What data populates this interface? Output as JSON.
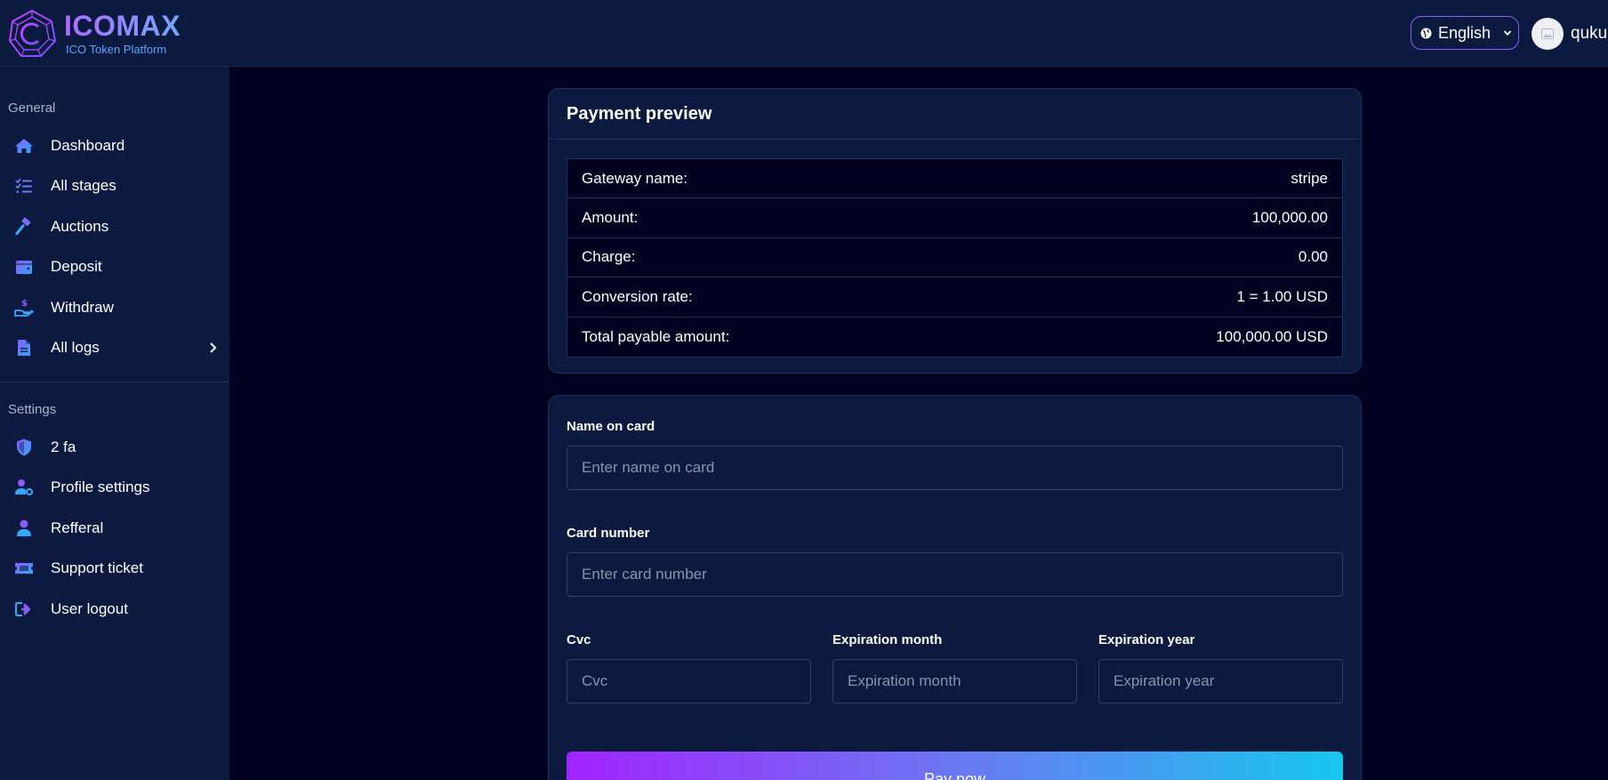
{
  "header": {
    "brand_title": "ICOMAX",
    "brand_subtitle": "ICO Token Platform",
    "language": "English",
    "username": "qukuq"
  },
  "sidebar": {
    "general_title": "General",
    "general_items": [
      {
        "label": "Dashboard",
        "icon": "home-icon"
      },
      {
        "label": "All stages",
        "icon": "list-icon"
      },
      {
        "label": "Auctions",
        "icon": "gavel-icon"
      },
      {
        "label": "Deposit",
        "icon": "wallet-icon"
      },
      {
        "label": "Withdraw",
        "icon": "hand-dollar-icon"
      },
      {
        "label": "All logs",
        "icon": "file-icon"
      }
    ],
    "settings_title": "Settings",
    "settings_items": [
      {
        "label": "2 fa",
        "icon": "shield-icon"
      },
      {
        "label": "Profile settings",
        "icon": "user-gear-icon"
      },
      {
        "label": "Refferal",
        "icon": "user-icon"
      },
      {
        "label": "Support ticket",
        "icon": "ticket-icon"
      },
      {
        "label": "User logout",
        "icon": "logout-icon"
      }
    ]
  },
  "payment_preview": {
    "title": "Payment preview",
    "rows": [
      {
        "label": "Gateway name:",
        "value": "stripe"
      },
      {
        "label": "Amount:",
        "value": "100,000.00"
      },
      {
        "label": "Charge:",
        "value": "0.00"
      },
      {
        "label": "Conversion rate:",
        "value": "1 = 1.00 USD"
      },
      {
        "label": "Total payable amount:",
        "value": "100,000.00 USD"
      }
    ]
  },
  "card_form": {
    "name_label": "Name on card",
    "name_placeholder": "Enter name on card",
    "number_label": "Card number",
    "number_placeholder": "Enter card number",
    "cvc_label": "Cvc",
    "cvc_placeholder": "Cvc",
    "month_label": "Expiration month",
    "month_placeholder": "Expiration month",
    "year_label": "Expiration year",
    "year_placeholder": "Expiration year",
    "submit_label": "Pay now"
  },
  "colors": {
    "page_bg": "#01021f",
    "panel_bg": "#0b1a3e",
    "accent_purple": "#a323ff",
    "accent_blue": "#4f6bff",
    "accent_cyan": "#17c6ee"
  }
}
